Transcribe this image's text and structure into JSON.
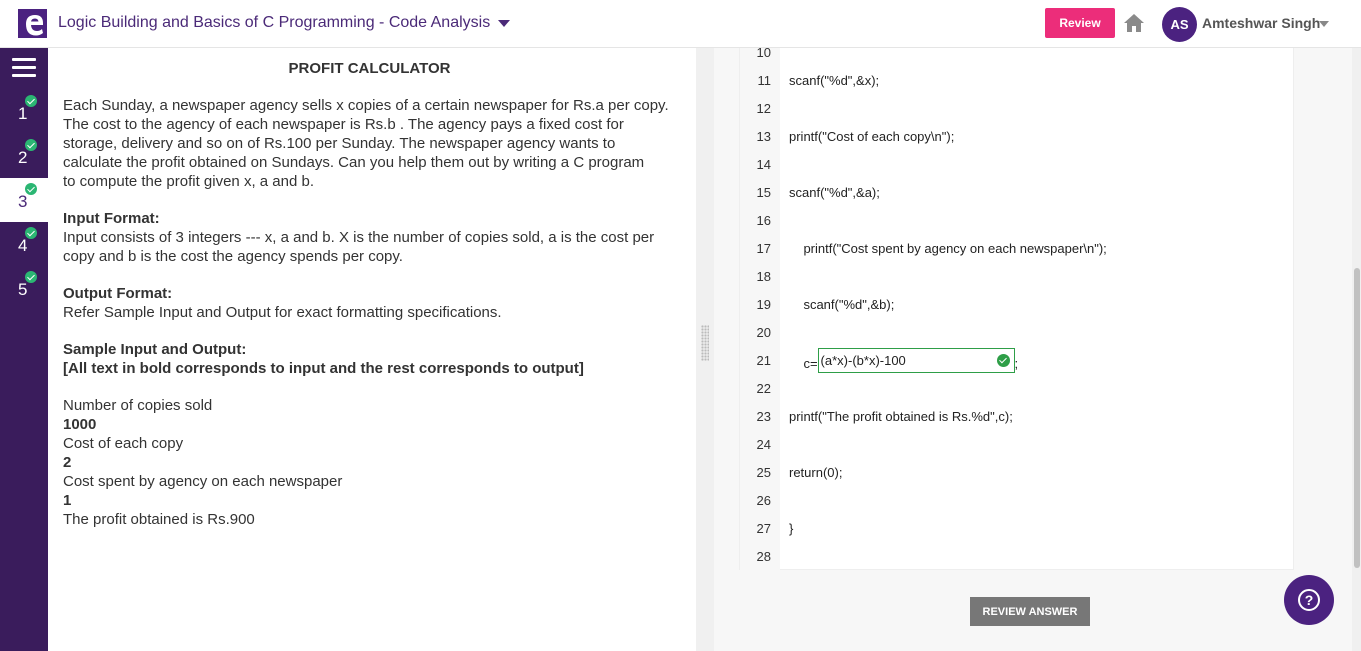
{
  "header": {
    "title": "Logic Building and Basics of C Programming - Code Analysis",
    "review_label": "Review",
    "user_initials": "AS",
    "user_name": "Amteshwar Singh"
  },
  "sidebar": {
    "questions": [
      {
        "num": "1",
        "completed": true,
        "active": false
      },
      {
        "num": "2",
        "completed": true,
        "active": false
      },
      {
        "num": "3",
        "completed": true,
        "active": true
      },
      {
        "num": "4",
        "completed": true,
        "active": false
      },
      {
        "num": "5",
        "completed": true,
        "active": false
      }
    ]
  },
  "problem": {
    "title": "PROFIT CALCULATOR",
    "description_lines": [
      "Each Sunday, a newspaper agency sells x copies of a certain newspaper for Rs.a per copy.",
      "The cost to the agency of each newspaper is Rs.b . The agency pays a fixed cost for",
      "storage, delivery and so on of Rs.100 per Sunday. The newspaper agency wants to",
      "calculate the profit obtained on Sundays. Can you help them out by writing a C program",
      "to compute the profit given x, a and b."
    ],
    "input_format_heading": "Input Format:",
    "input_format_lines": [
      "Input consists of 3 integers --- x, a and b. X is the number of copies sold, a is the cost per",
      "copy and b is the cost the agency spends per copy."
    ],
    "output_format_heading": "Output Format:",
    "output_format_text": "Refer Sample Input and Output for exact formatting specifications.",
    "sample_heading": "Sample Input and Output:",
    "sample_note": "[All text in bold corresponds to input and the rest corresponds to output]",
    "sample_lines": [
      {
        "text": "Number of copies sold",
        "bold": false
      },
      {
        "text": "1000",
        "bold": true
      },
      {
        "text": "Cost of each copy",
        "bold": false
      },
      {
        "text": "2",
        "bold": true
      },
      {
        "text": "Cost spent by agency on each newspaper",
        "bold": false
      },
      {
        "text": "1",
        "bold": true
      },
      {
        "text": "The profit obtained is Rs.900",
        "bold": false
      }
    ]
  },
  "code": {
    "lines": [
      {
        "num": "10",
        "text": ""
      },
      {
        "num": "11",
        "text": "scanf(\"%d\",&x);"
      },
      {
        "num": "12",
        "text": ""
      },
      {
        "num": "13",
        "text": "printf(\"Cost of each copy\\n\");"
      },
      {
        "num": "14",
        "text": ""
      },
      {
        "num": "15",
        "text": "scanf(\"%d\",&a);"
      },
      {
        "num": "16",
        "text": ""
      },
      {
        "num": "17",
        "text": "    printf(\"Cost spent by agency on each newspaper\\n\");"
      },
      {
        "num": "18",
        "text": ""
      },
      {
        "num": "19",
        "text": "    scanf(\"%d\",&b);"
      },
      {
        "num": "20",
        "text": ""
      },
      {
        "num": "21",
        "text": "    c=",
        "blank": "(a*x)-(b*x)-100",
        "after": ";"
      },
      {
        "num": "22",
        "text": ""
      },
      {
        "num": "23",
        "text": "printf(\"The profit obtained is Rs.%d\",c);"
      },
      {
        "num": "24",
        "text": ""
      },
      {
        "num": "25",
        "text": "return(0);"
      },
      {
        "num": "26",
        "text": ""
      },
      {
        "num": "27",
        "text": "}"
      },
      {
        "num": "28",
        "text": ""
      }
    ],
    "review_answer_label": "REVIEW ANSWER"
  },
  "colors": {
    "brand_purple": "#4b2280",
    "sidebar": "#3a1c5c",
    "review_pink": "#ec2d7a",
    "check_green": "#2bb673"
  },
  "icons": [
    "logo-icon",
    "caret-down-icon",
    "home-icon",
    "menu-icon",
    "check-icon",
    "help-icon"
  ]
}
